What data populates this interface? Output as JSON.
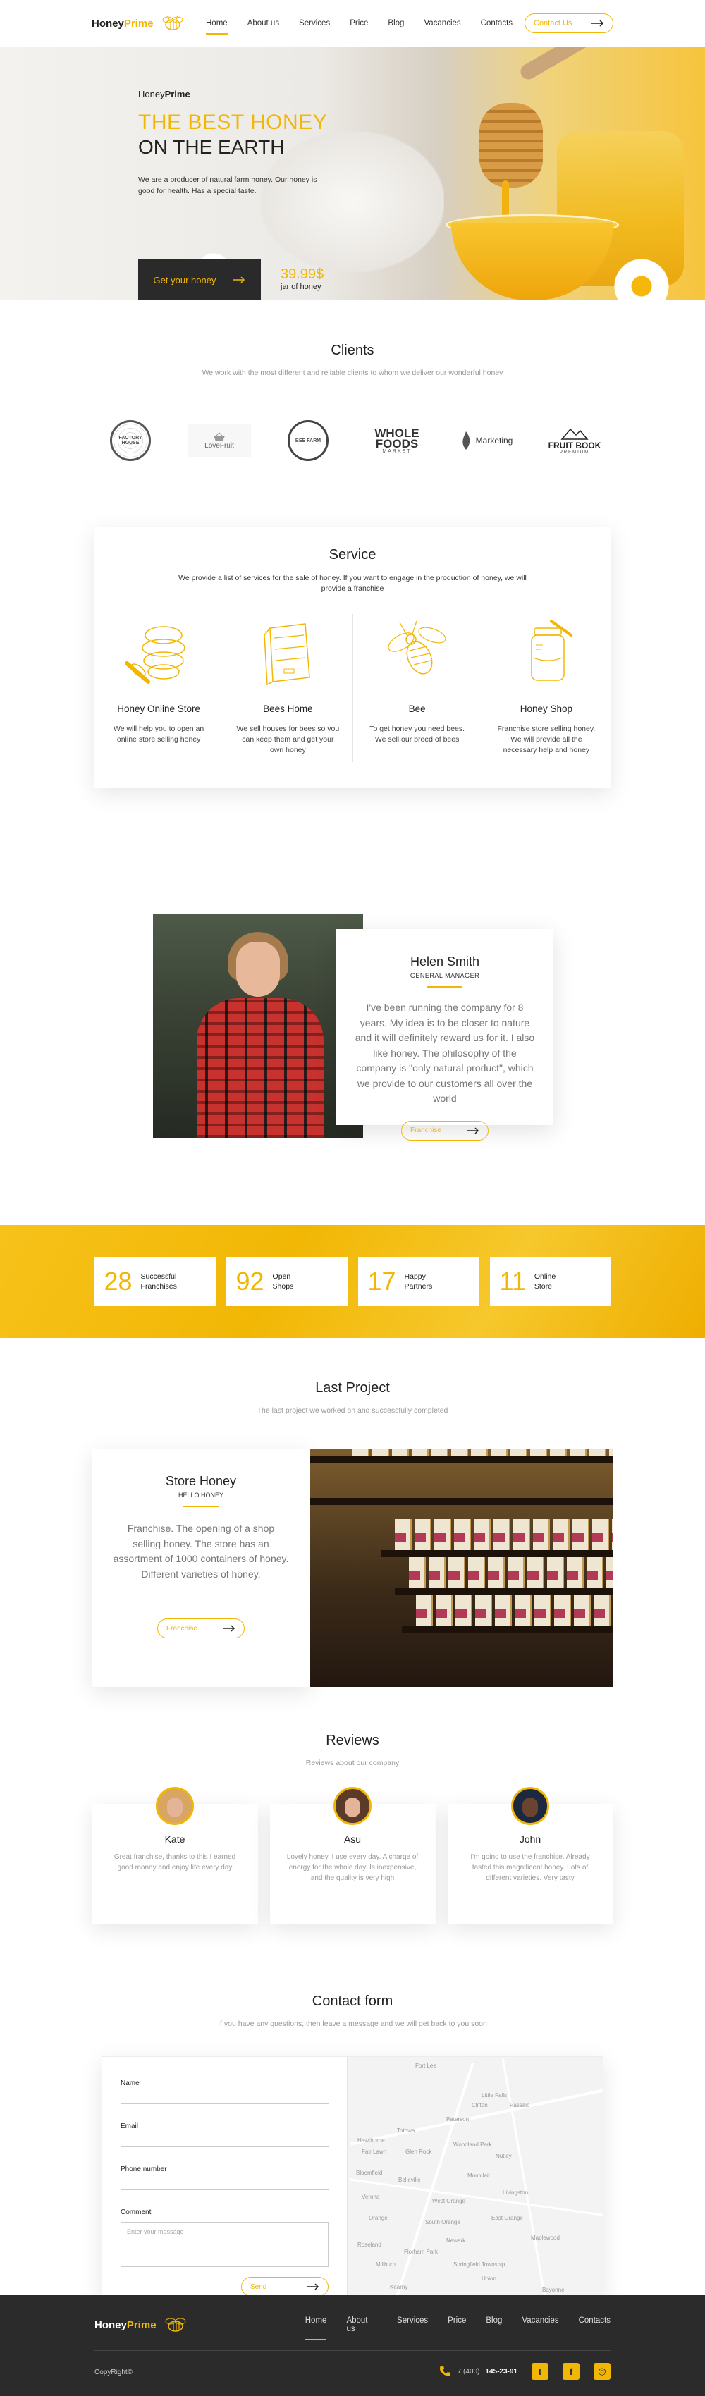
{
  "brand": {
    "part1": "Honey",
    "part2": "Prime"
  },
  "nav": [
    "Home",
    "About us",
    "Services",
    "Price",
    "Blog",
    "Vacancies",
    "Contacts"
  ],
  "header": {
    "contact_btn": "Contact Us"
  },
  "hero": {
    "brand_part1": "Honey",
    "brand_part2": "Prime",
    "title_line1": "THE BEST HONEY",
    "title_line2": "ON THE EARTH",
    "desc": "We are a producer of natural farm honey. Our honey is good for health. Has a special taste.",
    "cta": "Get your honey",
    "price": "39.99$",
    "price_unit": "jar of honey"
  },
  "clients": {
    "title": "Clients",
    "subtitle": "We work with the most different and reliable clients to whom we deliver our wonderful honey",
    "logos": [
      {
        "name": "FACTORY HOUSE"
      },
      {
        "name": "LoveFruit"
      },
      {
        "name": "BEE FARM"
      },
      {
        "name": "WHOLE FOODS",
        "sub": "MARKET"
      },
      {
        "name": "Marketing"
      },
      {
        "name": "FRUIT BOOK",
        "sub": "PREMIUM"
      }
    ]
  },
  "service": {
    "title": "Service",
    "desc": "We provide a list of services for the sale of honey. If you want to engage in the production of honey, we will provide a franchise",
    "items": [
      {
        "title": "Honey Online Store",
        "text": "We will help you to open an online store selling honey"
      },
      {
        "title": "Bees Home",
        "text": "We sell houses for bees so you can keep them and get your own honey"
      },
      {
        "title": "Bee",
        "text": "To get honey you need bees. We sell our breed of bees"
      },
      {
        "title": "Honey Shop",
        "text": "Franchise store selling honey. We will provide all the necessary help and honey"
      }
    ]
  },
  "testimonial": {
    "name": "Helen Smith",
    "role": "GENERAL MANAGER",
    "quote": "I've been running the company for 8 years. My idea is to be closer to nature and it will definitely reward us for it. I also like honey. The philosophy of the company is \"only natural product\", which we provide to our customers all over the world",
    "button": "Franchise"
  },
  "stats": [
    {
      "num": "28",
      "line1": "Successful",
      "line2": "Franchises"
    },
    {
      "num": "92",
      "line1": "Open",
      "line2": "Shops"
    },
    {
      "num": "17",
      "line1": "Happy",
      "line2": "Partners"
    },
    {
      "num": "11",
      "line1": "Online",
      "line2": "Store"
    }
  ],
  "project": {
    "title": "Last Project",
    "subtitle": "The last project we worked on and successfully completed",
    "name": "Store Honey",
    "role": "HELLO HONEY",
    "text": "Franchise. The opening of a shop selling honey. The store has an assortment of 1000 containers of honey. Different varieties of honey.",
    "button": "Franchise"
  },
  "reviews": {
    "title": "Reviews",
    "subtitle": "Reviews about our company",
    "items": [
      {
        "name": "Kate",
        "text": "Great franchise, thanks to this I earned good money and enjoy life every day"
      },
      {
        "name": "Asu",
        "text": "Lovely honey. I use every day. A charge of energy for the whole day. Is inexpensive, and the quality is very high"
      },
      {
        "name": "John",
        "text": "I'm going to use the franchise. Already tasted this magnificent honey. Lots of different varieties. Very tasty"
      }
    ]
  },
  "contact": {
    "title": "Contact form",
    "subtitle": "If you have any questions, then leave a message and we will get back to you soon",
    "fields": {
      "name": "Name",
      "email": "Email",
      "phone": "Phone number",
      "comment": "Comment"
    },
    "comment_placeholder": "Enter your message",
    "send": "Send",
    "map_labels": [
      "Fort Lee",
      "Little Falls",
      "Clifton",
      "Passaic",
      "Paterson",
      "Totowa",
      "Hawthorne",
      "Fair Lawn",
      "Glen Rock",
      "Woodland Park",
      "Nutley",
      "Bloomfield",
      "Belleville",
      "Montclair",
      "Verona",
      "West Orange",
      "Livingston",
      "Orange",
      "South Orange",
      "East Orange",
      "Newark",
      "Roseland",
      "Maplewood",
      "Millburn",
      "Florham Park",
      "Springfield Township",
      "Union",
      "Kearny",
      "Bayonne"
    ]
  },
  "footer": {
    "copyright": "CopyRight©",
    "phone_prefix": "7 (400)",
    "phone_main": "145-23-91"
  },
  "colors": {
    "accent": "#f2b705",
    "dark": "#2b2b2b"
  }
}
